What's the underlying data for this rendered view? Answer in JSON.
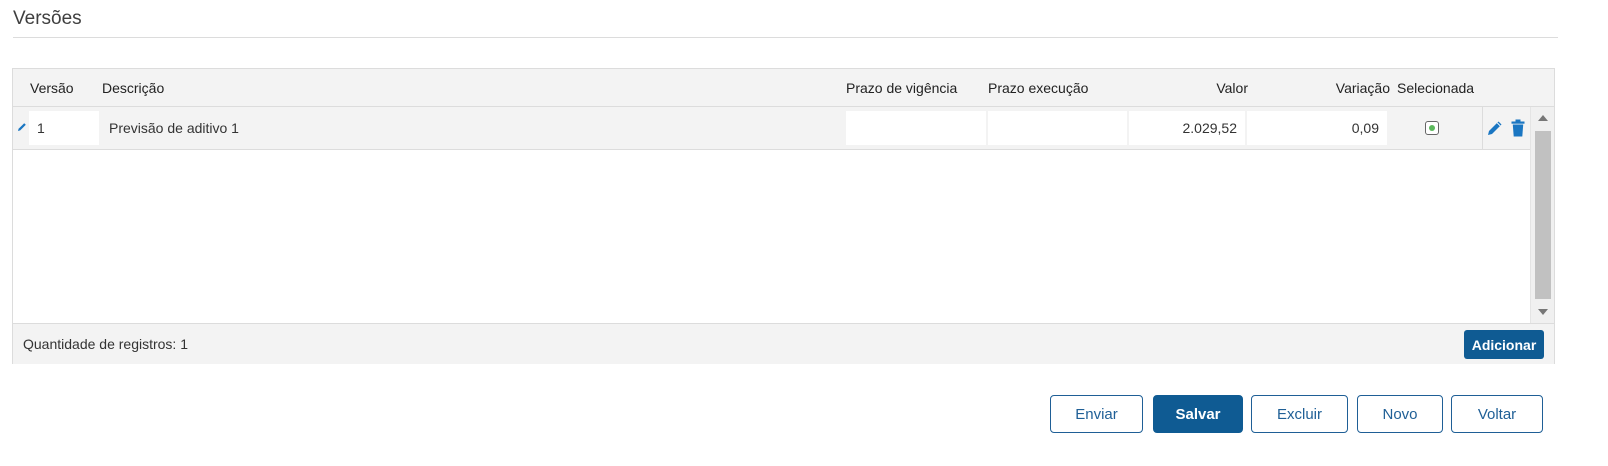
{
  "section": {
    "title": "Versões"
  },
  "grid": {
    "columns": [
      {
        "key": "versao",
        "label": "Versão"
      },
      {
        "key": "descricao",
        "label": "Descrição"
      },
      {
        "key": "prazo_vigencia",
        "label": "Prazo de vigência"
      },
      {
        "key": "prazo_execucao",
        "label": "Prazo execução"
      },
      {
        "key": "valor",
        "label": "Valor"
      },
      {
        "key": "variacao",
        "label": "Variação"
      },
      {
        "key": "selecionada",
        "label": "Selecionada"
      }
    ],
    "rows": [
      {
        "versao": "1",
        "descricao": "Previsão de aditivo 1",
        "prazo_vigencia": "",
        "prazo_execucao": "",
        "valor": "2.029,52",
        "variacao": "0,09",
        "selecionada": true
      }
    ],
    "footer": {
      "count_text": "Quantidade de registros: 1",
      "add_label": "Adicionar"
    }
  },
  "actions": {
    "enviar": "Enviar",
    "salvar": "Salvar",
    "excluir": "Excluir",
    "novo": "Novo",
    "voltar": "Voltar"
  },
  "colors": {
    "primary": "#0f5b93",
    "selected_dot": "#5cb85c",
    "icon_blue": "#1a76c2"
  },
  "icons": {
    "row_edit": "pencil-icon",
    "edit": "pencil-icon",
    "delete": "trash-icon"
  }
}
